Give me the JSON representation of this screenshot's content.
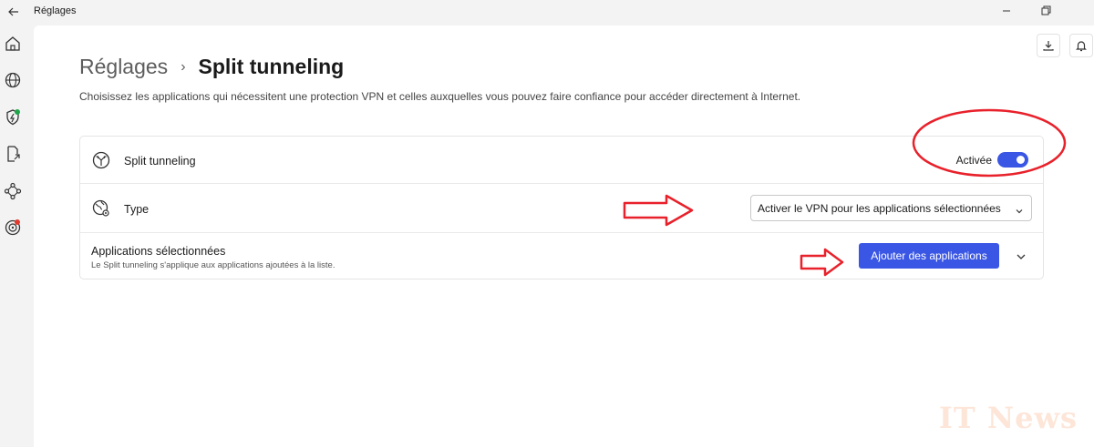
{
  "window": {
    "title": "Réglages",
    "back_icon": "back-arrow-icon",
    "controls": [
      "minimize-icon",
      "restore-icon"
    ]
  },
  "sidebar": {
    "items": [
      {
        "icon": "home-icon"
      },
      {
        "icon": "globe-icon"
      },
      {
        "icon": "shield-bolt-icon",
        "badge_color": "#1fa64a"
      },
      {
        "icon": "file-export-icon"
      },
      {
        "icon": "mesh-network-icon"
      },
      {
        "icon": "target-icon",
        "badge_color": "#e23a2e"
      }
    ]
  },
  "toolbar": {
    "download_icon": "download-icon",
    "notification_icon": "bell-icon"
  },
  "breadcrumb": {
    "parent": "Réglages",
    "separator": "›",
    "current": "Split tunneling"
  },
  "description": "Choisissez les applications qui nécessitent une protection VPN et celles auxquelles vous pouvez faire confiance pour accéder directement à Internet.",
  "settings": {
    "split_tunneling": {
      "icon": "split-icon",
      "label": "Split tunneling",
      "status_label": "Activée",
      "enabled": true
    },
    "type": {
      "icon": "globe-gear-icon",
      "label": "Type",
      "selected_option": "Activer le VPN pour les applications sélectionnées"
    },
    "applications": {
      "title": "Applications sélectionnées",
      "subtitle": "Le Split tunneling s'applique aux applications ajoutées à la liste.",
      "add_button_label": "Ajouter des applications"
    }
  },
  "colors": {
    "accent": "#3a56e4",
    "annotation": "#e8212b"
  },
  "watermark": "IT News"
}
